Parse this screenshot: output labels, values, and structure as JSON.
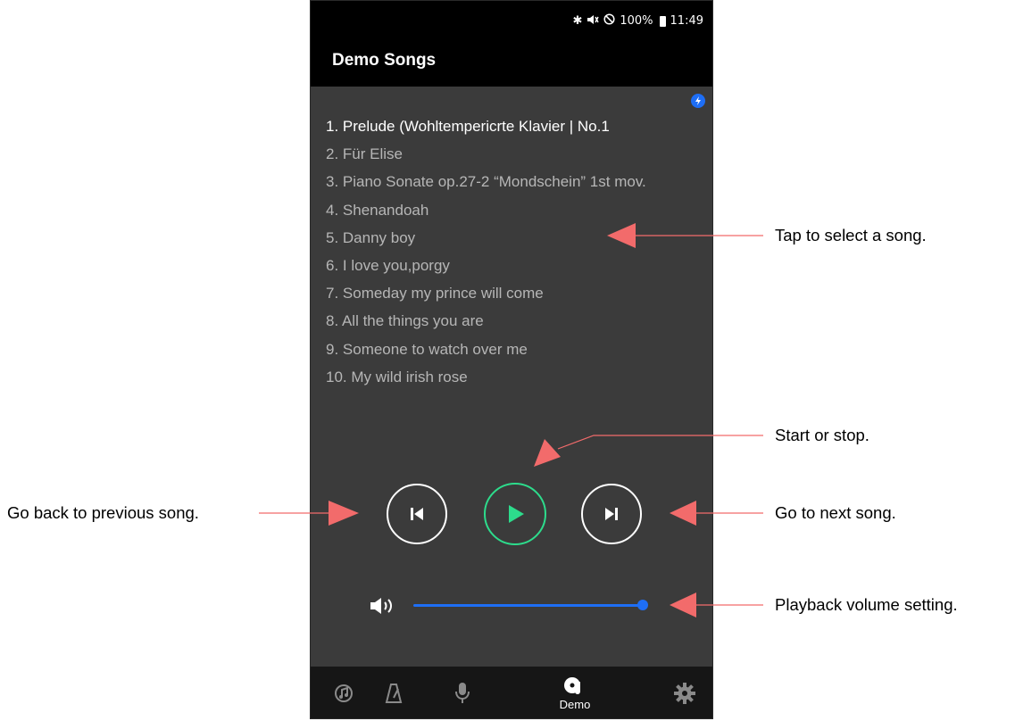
{
  "status_bar": {
    "battery": "100%",
    "time": "11:49",
    "icons": [
      "bluetooth-icon",
      "mute-icon",
      "do-not-disturb-icon",
      "battery-icon"
    ]
  },
  "app_bar": {
    "title": "Demo Songs"
  },
  "songs": [
    {
      "label": "1. Prelude (Wohltempericrte Klavier | No.1",
      "selected": true
    },
    {
      "label": "2. Für Elise",
      "selected": false
    },
    {
      "label": "3. Piano Sonate op.27-2 “Mondschein” 1st mov.",
      "selected": false
    },
    {
      "label": "4. Shenandoah",
      "selected": false
    },
    {
      "label": "5. Danny boy",
      "selected": false
    },
    {
      "label": "6. I love you,porgy",
      "selected": false
    },
    {
      "label": "7. Someday my prince will come",
      "selected": false
    },
    {
      "label": "8. All the things you are",
      "selected": false
    },
    {
      "label": "9. Someone to watch over me",
      "selected": false
    },
    {
      "label": "10. My wild irish rose",
      "selected": false
    }
  ],
  "playback": {
    "controls": [
      "previous-icon",
      "play-icon",
      "next-icon"
    ],
    "volume_fraction": 0.98
  },
  "bottom_nav": {
    "items": [
      "rhythm-icon",
      "metronome-icon",
      "microphone-icon",
      "demo-icon",
      "settings-icon"
    ],
    "demo_label": "Demo",
    "active": "demo"
  },
  "callouts": {
    "select_song": "Tap to select a song.",
    "start_stop": "Start or stop.",
    "previous": "Go back to previous song.",
    "next": "Go to next song.",
    "volume": "Playback volume setting."
  },
  "colors": {
    "content_bg": "#3b3b3b",
    "accent_blue": "#1e6ef5",
    "play_green": "#2ddc8c",
    "callout_arrow": "#f26b6b"
  }
}
